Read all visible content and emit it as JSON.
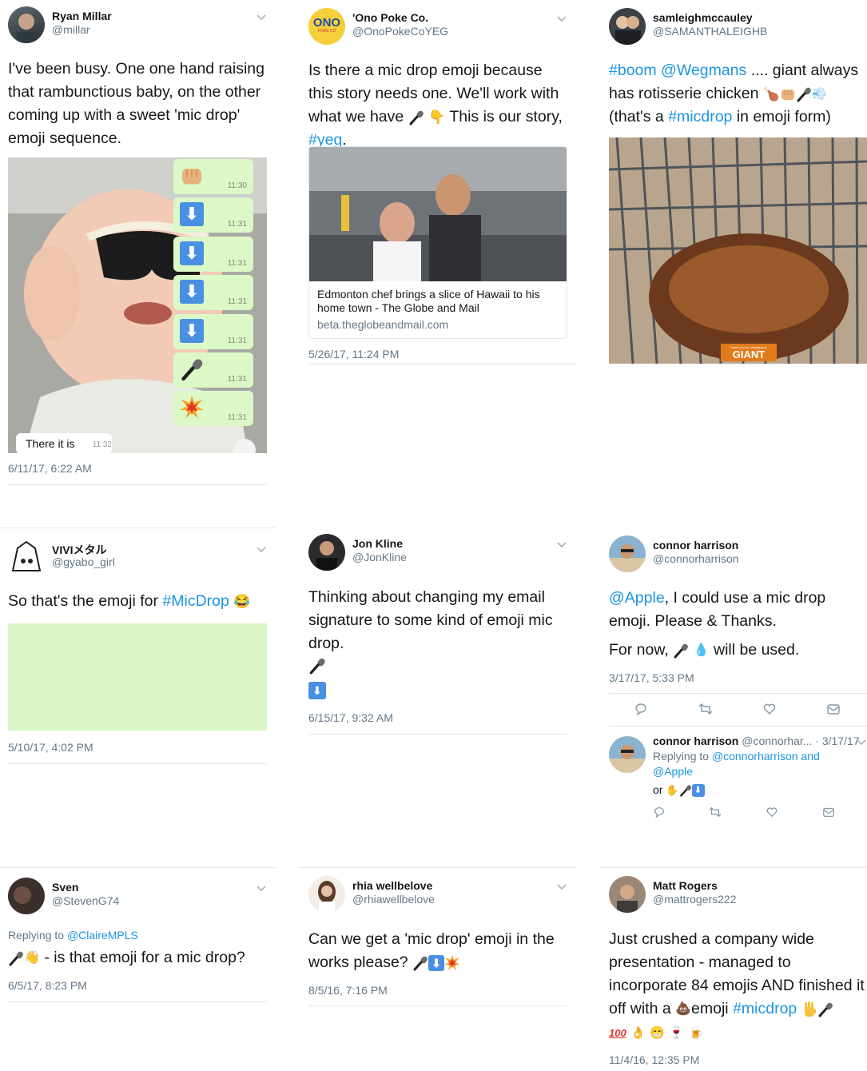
{
  "tweets": [
    {
      "name": "Ryan Millar",
      "handle": "@millar",
      "text": "I've been busy. One one hand raising that rambunctious baby, on the other coming up with a sweet 'mic drop' emoji sequence.",
      "time": "6/11/17, 6:22 AM",
      "chat": {
        "times": [
          "11:30",
          "11:31",
          "11:31",
          "11:31",
          "11:31",
          "11:31",
          "11:31"
        ],
        "last_message": "There it is",
        "last_time": "11:32"
      }
    },
    {
      "name": "'Ono Poke Co.",
      "handle": "@OnoPokeCoYEG",
      "text_a": "Is there a mic drop emoji because this story needs one. We'll work with what we have",
      "text_b": "This is our story,",
      "hashtag": "#yeg",
      "text_c": ".",
      "logo_text": "ONO",
      "logo_sub": "POKE CO",
      "card_title": "Edmonton chef brings a slice of Hawaii to his home town - The Globe and Mail",
      "card_domain": "beta.theglobeandmail.com",
      "time": "5/26/17, 11:24 PM"
    },
    {
      "name": "samleighmccauley",
      "handle": "@SAMANTHALEIGHB",
      "hashtag1": "#boom",
      "mention": "@Wegmans",
      "text_a": ".... giant always has rotisserie chicken",
      "text_b": "(that's a",
      "hashtag2": "#micdrop",
      "text_c": "in emoji form)",
      "giant_label": "GIANT",
      "giant_sub": "thank you for shopping at"
    },
    {
      "name": "VIVIメタル",
      "handle": "@gyabo_girl",
      "text": "So that's the emoji for",
      "hashtag": "#MicDrop",
      "time": "5/10/17, 4:02 PM"
    },
    {
      "name": "Jon Kline",
      "handle": "@JonKline",
      "text": "Thinking about changing my email signature to some kind of emoji mic drop.",
      "time": "6/15/17, 9:32 AM"
    },
    {
      "name": "connor harrison",
      "handle": "@connorharrison",
      "mention": "@Apple",
      "text_a": ", I could use a mic drop emoji. Please & Thanks.",
      "text_b": "For now,",
      "text_c": "will be used.",
      "time": "3/17/17, 5:33 PM",
      "reply": {
        "name": "connor harrison",
        "handle": "@connorhar...",
        "date": "· 3/17/17",
        "replying_label": "Replying to",
        "replying_to": "@connorharrison and @Apple",
        "text": "or"
      }
    },
    {
      "name": "Sven",
      "handle": "@StevenG74",
      "replying_label": "Replying to",
      "replying_to": "@ClaireMPLS",
      "text": "- is that emoji for a mic drop?",
      "time": "6/5/17, 8:23 PM"
    },
    {
      "name": "rhia wellbelove",
      "handle": "@rhiawellbelove",
      "text": "Can we get a 'mic drop' emoji in the works please?",
      "time": "8/5/16, 7:16 PM"
    },
    {
      "name": "Matt Rogers",
      "handle": "@mattrogers222",
      "text_a": "Just crushed a company wide presentation - managed to incorporate 84 emojis AND finished it off with a",
      "text_b": "emoji",
      "hashtag": "#micdrop",
      "badge_100": "100",
      "time": "11/4/16, 12:35 PM"
    }
  ],
  "colors": {
    "link": "#1b95e0",
    "meta": "#657786",
    "text": "#14171a",
    "chat_bubble": "#dcf8c6"
  },
  "icons": [
    "chevron-down-icon",
    "reply-icon",
    "retweet-icon",
    "like-icon",
    "dm-icon",
    "mic-icon",
    "fist-icon",
    "down-arrow-icon",
    "collision-icon",
    "hand-icon"
  ]
}
